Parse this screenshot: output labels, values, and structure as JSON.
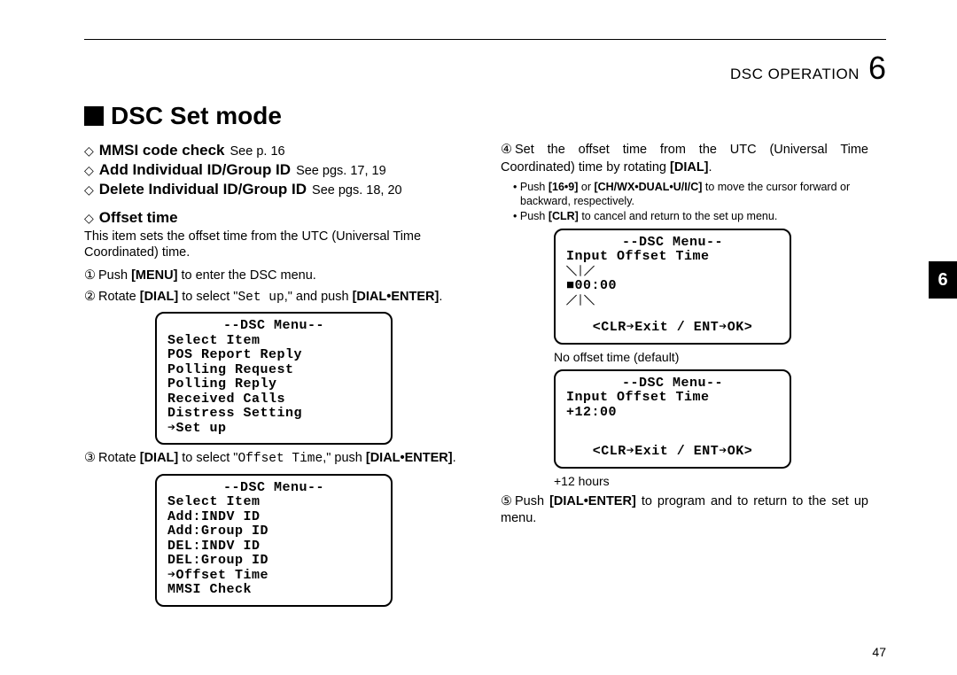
{
  "header": {
    "section": "DSC OPERATION",
    "chapter": "6"
  },
  "title": "DSC Set mode",
  "left": {
    "sub1_label": "MMSI code check",
    "sub1_see": "See p. 16",
    "sub2_label": "Add Individual ID/Group ID",
    "sub2_see": "See pgs. 17, 19",
    "sub3_label": "Delete Individual ID/Group ID",
    "sub3_see": "See pgs. 18, 20",
    "sub4_label": "Offset time",
    "offset_desc": "This item sets the offset time from the UTC (Universal Time Coordinated) time.",
    "step1_a": "Push ",
    "step1_key": "[MENU]",
    "step1_b": " to enter the DSC menu.",
    "step2_a": "Rotate ",
    "step2_key": "[DIAL]",
    "step2_b": " to select \"",
    "step2_mono": "Set up",
    "step2_c": ",\" and push ",
    "step2_key2": "[DIAL•ENTER]",
    "step2_d": ".",
    "lcd1": {
      "l1": "--DSC Menu--",
      "l2": "Select Item",
      "l3": " POS Report Reply",
      "l4": " Polling Request",
      "l5": " Polling Reply",
      "l6": " Received Calls",
      "l7": " Distress Setting",
      "l8": "➔Set up"
    },
    "step3_a": "Rotate ",
    "step3_key": "[DIAL]",
    "step3_b": " to select \"",
    "step3_mono": "Offset Time",
    "step3_c": ",\" push ",
    "step3_key2": "[DIAL•ENTER]",
    "step3_d": ".",
    "lcd2": {
      "l1": "--DSC Menu--",
      "l2": "Select Item",
      "l3": " Add:INDV ID",
      "l4": " Add:Group ID",
      "l5": " DEL:INDV ID",
      "l6": " DEL:Group ID",
      "l7": "➔Offset Time",
      "l8": " MMSI Check"
    }
  },
  "right": {
    "step4_a": "Set the offset time from the UTC (Universal Time Coordinated) time by rotating ",
    "step4_key": "[DIAL]",
    "step4_b": ".",
    "bullet1_a": "Push ",
    "bullet1_k1": "[16•9]",
    "bullet1_b": " or ",
    "bullet1_k2": "[CH/WX•DUAL•U/I/C]",
    "bullet1_c": " to move the cursor forward or backward, respectively.",
    "bullet2_a": "Push ",
    "bullet2_k1": "[CLR]",
    "bullet2_b": " to cancel and return to the set up menu.",
    "lcd3": {
      "l1": "--DSC Menu--",
      "l2": "Input Offset Time",
      "l3": "■00:00",
      "bottom": "<CLR➔Exit / ENT➔OK>"
    },
    "caption3": "No offset time (default)",
    "lcd4": {
      "l1": "--DSC Menu--",
      "l2": "Input Offset Time",
      "l3": "+12:00",
      "bottom": "<CLR➔Exit / ENT➔OK>"
    },
    "caption4": "+12 hours",
    "step5_a": "Push ",
    "step5_key": "[DIAL•ENTER]",
    "step5_b": " to program and to return to the set up menu."
  },
  "sidetab": "6",
  "pagenum": "47"
}
